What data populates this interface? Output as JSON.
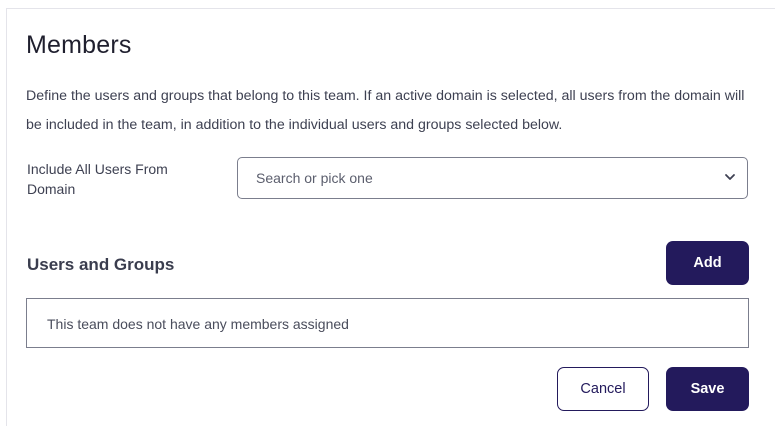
{
  "members": {
    "title": "Members",
    "description": "Define the users and groups that belong to this team. If an active domain is selected, all users from the domain will be included in the team, in addition to the individual users and groups selected below.",
    "domain_label": "Include All Users From Domain",
    "domain_select": {
      "placeholder": "Search or pick one",
      "icon": "chevron-down-icon"
    },
    "users_groups": {
      "title": "Users and Groups",
      "add_label": "Add",
      "empty_text": "This team does not have any members assigned"
    },
    "actions": {
      "cancel_label": "Cancel",
      "save_label": "Save"
    }
  },
  "colors": {
    "primary": "#231a5c",
    "border": "#7b7e8d"
  }
}
